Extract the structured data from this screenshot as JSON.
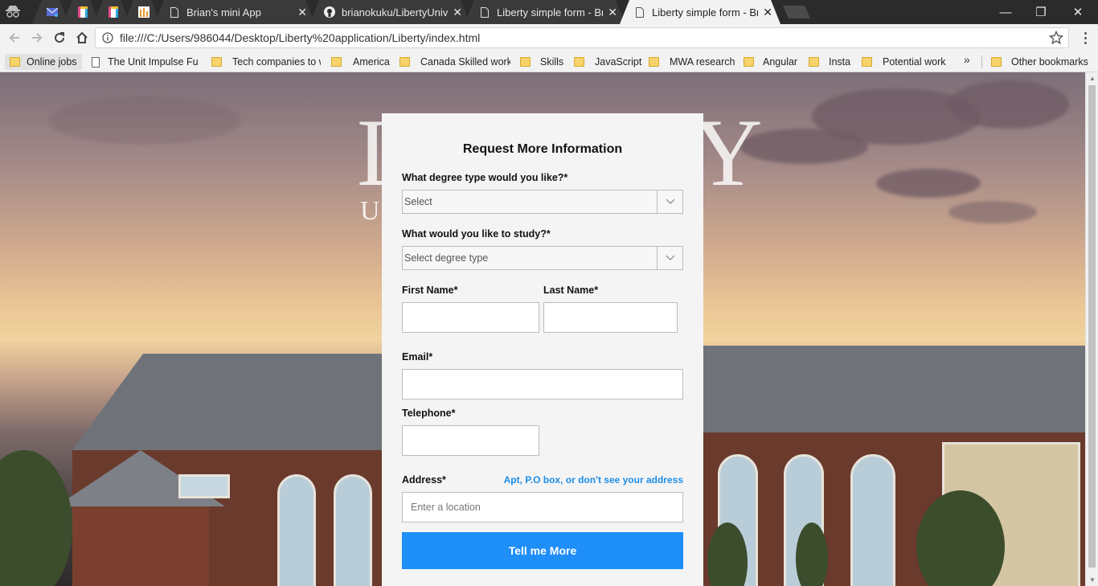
{
  "browser": {
    "tabs": [
      {
        "title": "",
        "icon": "mail-icon",
        "active": false
      },
      {
        "title": "",
        "icon": "colorful-doc-icon",
        "active": false
      },
      {
        "title": "",
        "icon": "colorful-doc-icon",
        "active": false
      },
      {
        "title": "",
        "icon": "chart-icon",
        "active": false
      },
      {
        "title": "Brian's mini App",
        "icon": "page-icon",
        "active": false
      },
      {
        "title": "brianokuku/LibertyUniver",
        "icon": "github-icon",
        "active": false
      },
      {
        "title": "Liberty simple form - Bria",
        "icon": "page-icon",
        "active": false
      },
      {
        "title": "Liberty simple form - Bria",
        "icon": "page-icon",
        "active": true
      }
    ],
    "close_glyph": "✕",
    "window_controls": {
      "minimize": "—",
      "restore": "❐",
      "close": "✕"
    },
    "address": "file:///C:/Users/986044/Desktop/Liberty%20application/Liberty/index.html",
    "bookmarks": [
      {
        "label": "Online jobs",
        "type": "folder"
      },
      {
        "label": "The Unit Impulse Fu",
        "type": "page"
      },
      {
        "label": "Tech companies to w",
        "type": "folder"
      },
      {
        "label": "America",
        "type": "folder"
      },
      {
        "label": "Canada Skilled work",
        "type": "folder"
      },
      {
        "label": "Skills",
        "type": "folder"
      },
      {
        "label": "JavaScript",
        "type": "folder"
      },
      {
        "label": "MWA research",
        "type": "folder"
      },
      {
        "label": "Angular",
        "type": "folder"
      },
      {
        "label": "Insta",
        "type": "folder"
      },
      {
        "label": "Potential work",
        "type": "folder"
      }
    ],
    "bookmarks_overflow": "»",
    "other_bookmarks": "Other bookmarks"
  },
  "hero": {
    "logo_letters_left": "L",
    "logo_letters_right": "Y",
    "logo_sub": "U"
  },
  "form": {
    "title": "Request More Information",
    "degree_type": {
      "label": "What degree type would you like?*",
      "value": "Select"
    },
    "study": {
      "label": "What would you like to study?*",
      "value": "Select degree type"
    },
    "first_name": {
      "label": "First Name*",
      "value": ""
    },
    "last_name": {
      "label": "Last Name*",
      "value": ""
    },
    "email": {
      "label": "Email*",
      "value": ""
    },
    "telephone": {
      "label": "Telephone*",
      "value": ""
    },
    "address": {
      "label": "Address*",
      "placeholder": "Enter a location",
      "help_link": "Apt, P.O box, or don't see your address"
    },
    "submit_label": "Tell me More"
  },
  "colors": {
    "accent": "#1e8ef8",
    "link": "#1e8ee8",
    "card_bg": "#f4f4f4"
  }
}
